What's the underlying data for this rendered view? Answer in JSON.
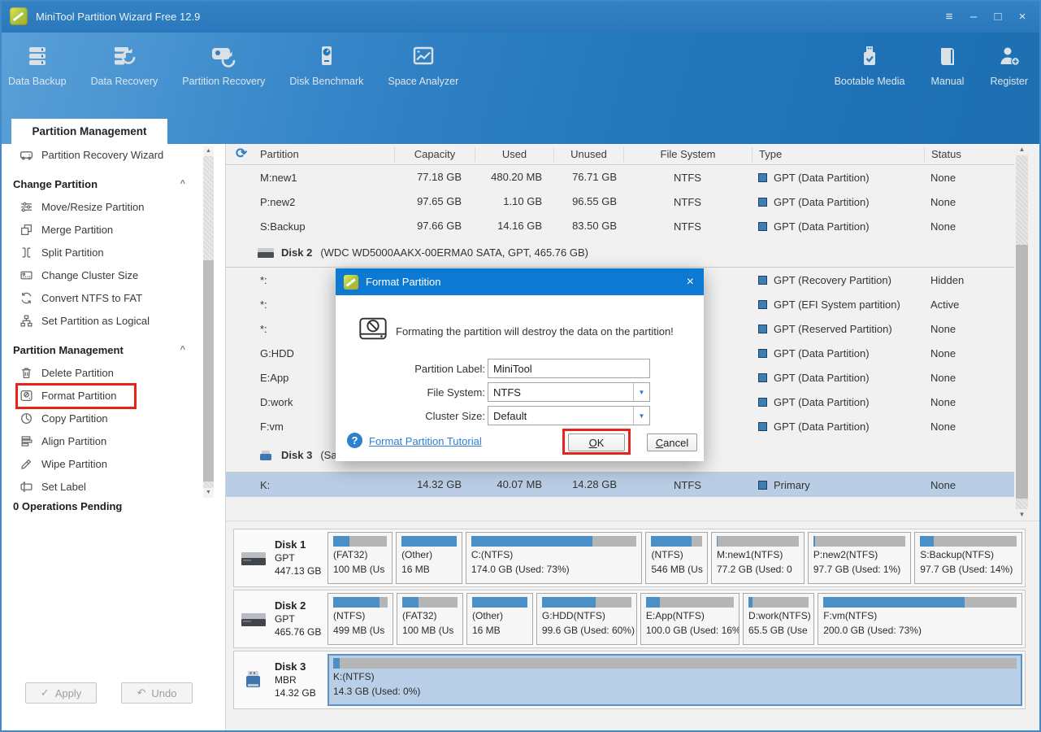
{
  "window": {
    "title": "MiniTool Partition Wizard Free 12.9"
  },
  "icons": {
    "menu": "≡",
    "minimize": "–",
    "maximize": "□",
    "close": "×",
    "chevron_up": "^",
    "scroll_up": "▲",
    "scroll_down": "▼",
    "dropdown": "▼",
    "check": "✓",
    "undo_arrow": "↶",
    "refresh": "⟳",
    "question": "?"
  },
  "colors": {
    "titlebar_blue": "#2b7ac0",
    "dialog_title_blue": "#0c79d2",
    "selection_blue": "#b9cee5",
    "bar_fill_blue": "#4a8fc6",
    "highlight_red": "#e8231a",
    "link_blue": "#2a7fd4",
    "type_square_blue": "#3e7fb1"
  },
  "toolbar": {
    "items": [
      {
        "label": "Data Backup"
      },
      {
        "label": "Data Recovery"
      },
      {
        "label": "Partition Recovery"
      },
      {
        "label": "Disk Benchmark"
      },
      {
        "label": "Space Analyzer"
      }
    ],
    "right_items": [
      {
        "label": "Bootable Media"
      },
      {
        "label": "Manual"
      },
      {
        "label": "Register"
      }
    ]
  },
  "tab": {
    "label": "Partition Management"
  },
  "sidebar": {
    "wizard": {
      "label": "Partition Recovery Wizard"
    },
    "sections": [
      {
        "title": "Change Partition",
        "items": [
          {
            "label": "Move/Resize Partition"
          },
          {
            "label": "Merge Partition"
          },
          {
            "label": "Split Partition"
          },
          {
            "label": "Change Cluster Size"
          },
          {
            "label": "Convert NTFS to FAT"
          },
          {
            "label": "Set Partition as Logical"
          }
        ]
      },
      {
        "title": "Partition Management",
        "items": [
          {
            "label": "Delete Partition"
          },
          {
            "label": "Format Partition"
          },
          {
            "label": "Copy Partition"
          },
          {
            "label": "Align Partition"
          },
          {
            "label": "Wipe Partition"
          },
          {
            "label": "Set Label"
          }
        ]
      }
    ],
    "pending": "0 Operations Pending",
    "apply": "Apply",
    "undo": "Undo"
  },
  "table": {
    "columns": [
      "Partition",
      "Capacity",
      "Used",
      "Unused",
      "File System",
      "Type",
      "Status"
    ],
    "rows": [
      {
        "kind": "part",
        "name": "M:new1",
        "capacity": "77.18 GB",
        "used": "480.20 MB",
        "unused": "76.71 GB",
        "fs": "NTFS",
        "ptype": "GPT (Data Partition)",
        "status": "None"
      },
      {
        "kind": "part",
        "name": "P:new2",
        "capacity": "97.65 GB",
        "used": "1.10 GB",
        "unused": "96.55 GB",
        "fs": "NTFS",
        "ptype": "GPT (Data Partition)",
        "status": "None"
      },
      {
        "kind": "part",
        "name": "S:Backup",
        "capacity": "97.66 GB",
        "used": "14.16 GB",
        "unused": "83.50 GB",
        "fs": "NTFS",
        "ptype": "GPT (Data Partition)",
        "status": "None"
      },
      {
        "kind": "disk",
        "name": "Disk 2",
        "info": "(WDC WD5000AAKX-00ERMA0 SATA, GPT, 465.76 GB)"
      },
      {
        "kind": "part",
        "name": "*:",
        "capacity": "",
        "used": "",
        "unused": "",
        "fs": "",
        "ptype": "GPT (Recovery Partition)",
        "status": "Hidden"
      },
      {
        "kind": "part",
        "name": "*:",
        "capacity": "",
        "used": "",
        "unused": "",
        "fs": "",
        "ptype": "GPT (EFI System partition)",
        "status": "Active"
      },
      {
        "kind": "part",
        "name": "*:",
        "capacity": "",
        "used": "",
        "unused": "",
        "fs": "",
        "ptype": "GPT (Reserved Partition)",
        "status": "None"
      },
      {
        "kind": "part",
        "name": "G:HDD",
        "capacity": "",
        "used": "",
        "unused": "",
        "fs": "",
        "ptype": "GPT (Data Partition)",
        "status": "None"
      },
      {
        "kind": "part",
        "name": "E:App",
        "capacity": "",
        "used": "",
        "unused": "",
        "fs": "",
        "ptype": "GPT (Data Partition)",
        "status": "None"
      },
      {
        "kind": "part",
        "name": "D:work",
        "capacity": "",
        "used": "",
        "unused": "",
        "fs": "",
        "ptype": "GPT (Data Partition)",
        "status": "None"
      },
      {
        "kind": "part",
        "name": "F:vm",
        "capacity": "",
        "used": "",
        "unused": "",
        "fs": "",
        "ptype": "GPT (Data Partition)",
        "status": "None"
      },
      {
        "kind": "disk",
        "name": "Disk 3",
        "info": "(Sa"
      },
      {
        "kind": "part",
        "name": "K:",
        "capacity": "14.32 GB",
        "used": "40.07 MB",
        "unused": "14.28 GB",
        "fs": "NTFS",
        "ptype": "Primary",
        "status": "None",
        "selected": true
      }
    ]
  },
  "disks": [
    {
      "name": "Disk 1",
      "scheme": "GPT",
      "size": "447.13 GB",
      "partitions": [
        {
          "label": "(FAT32)",
          "size": "100 MB (Us",
          "pct": 30
        },
        {
          "label": "(Other)",
          "size": "16 MB",
          "pct": 100
        },
        {
          "label": "C:(NTFS)",
          "size": "174.0 GB (Used: 73%)",
          "pct": 73
        },
        {
          "label": "(NTFS)",
          "size": "546 MB (Us",
          "pct": 80
        },
        {
          "label": "M:new1(NTFS)",
          "size": "77.2 GB (Used: 0",
          "pct": 1
        },
        {
          "label": "P:new2(NTFS)",
          "size": "97.7 GB (Used: 1%)",
          "pct": 2
        },
        {
          "label": "S:Backup(NTFS)",
          "size": "97.7 GB (Used: 14%)",
          "pct": 14
        }
      ]
    },
    {
      "name": "Disk 2",
      "scheme": "GPT",
      "size": "465.76 GB",
      "partitions": [
        {
          "label": "(NTFS)",
          "size": "499 MB (Us",
          "pct": 85
        },
        {
          "label": "(FAT32)",
          "size": "100 MB (Us",
          "pct": 30
        },
        {
          "label": "(Other)",
          "size": "16 MB",
          "pct": 100
        },
        {
          "label": "G:HDD(NTFS)",
          "size": "99.6 GB (Used: 60%)",
          "pct": 60
        },
        {
          "label": "E:App(NTFS)",
          "size": "100.0 GB (Used: 16%)",
          "pct": 16
        },
        {
          "label": "D:work(NTFS)",
          "size": "65.5 GB (Use",
          "pct": 7
        },
        {
          "label": "F:vm(NTFS)",
          "size": "200.0 GB (Used: 73%)",
          "pct": 73
        }
      ]
    },
    {
      "name": "Disk 3",
      "scheme": "MBR",
      "size": "14.32 GB",
      "partitions": [
        {
          "label": "K:(NTFS)",
          "size": "14.3 GB (Used: 0%)",
          "pct": 1,
          "selected": true
        }
      ]
    }
  ],
  "dialog": {
    "title": "Format Partition",
    "warning": "Formating the partition will destroy the data on the partition!",
    "fields": [
      {
        "label": "Partition Label:",
        "value": "MiniTool"
      },
      {
        "label": "File System:",
        "value": "NTFS"
      },
      {
        "label": "Cluster Size:",
        "value": "Default"
      }
    ],
    "link": "Format Partition Tutorial",
    "ok": "OK",
    "cancel": "Cancel"
  }
}
